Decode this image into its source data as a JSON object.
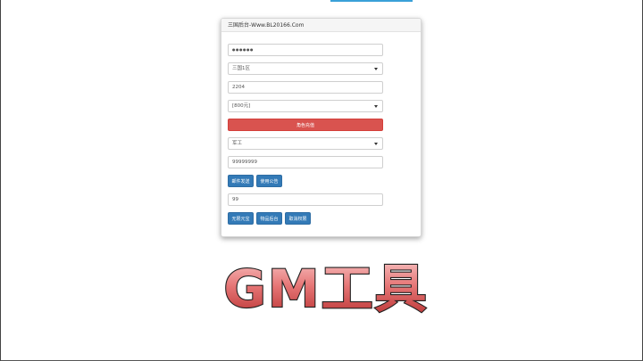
{
  "panel": {
    "title": "三国后台-Www.BL20166.Com",
    "password_value": "●●●●●●",
    "server_select": "三国1区",
    "role_id": "2204",
    "recharge_select": "[800元]",
    "recharge_button": "角色充值",
    "item_select": "军工",
    "quantity": "99999999",
    "mail_send_button": "邮件发送",
    "use_announcement_button": "使用公告",
    "count_value": "99",
    "unlimited_yuanbao_button": "无限元宝",
    "item_backend_button": "物品后台",
    "cancel_permission_button": "取消权限"
  },
  "banner": {
    "text": "GM工具"
  },
  "colors": {
    "red_button": "#d9534f",
    "blue_button": "#337ab7",
    "banner_fill": "#e06c6c",
    "accent": "#3aa0d8"
  }
}
